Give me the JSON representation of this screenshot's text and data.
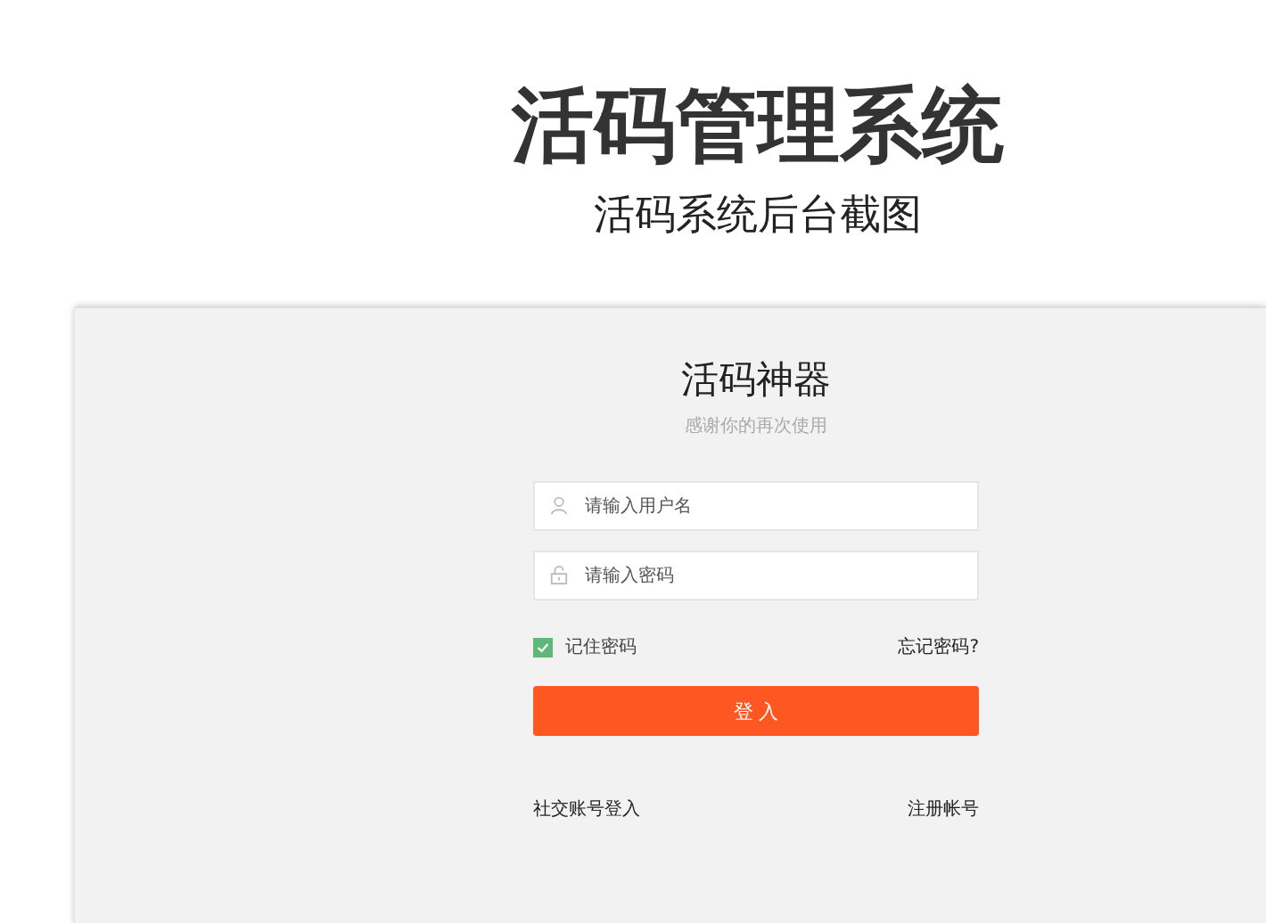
{
  "headline": "活码管理系统",
  "subheadline": "活码系统后台截图",
  "login": {
    "title": "活码神器",
    "subtitle": "感谢你的再次使用",
    "fields": [
      {
        "kind": "user",
        "placeholder": "请输入用户名"
      },
      {
        "kind": "password",
        "placeholder": "请输入密码"
      }
    ],
    "remember": {
      "label": "记住密码",
      "checked": true
    },
    "forgot_link": "忘记密码?",
    "submit_button": "登 入",
    "social_login_link": "社交账号登入",
    "register_link": "注册帐号"
  }
}
